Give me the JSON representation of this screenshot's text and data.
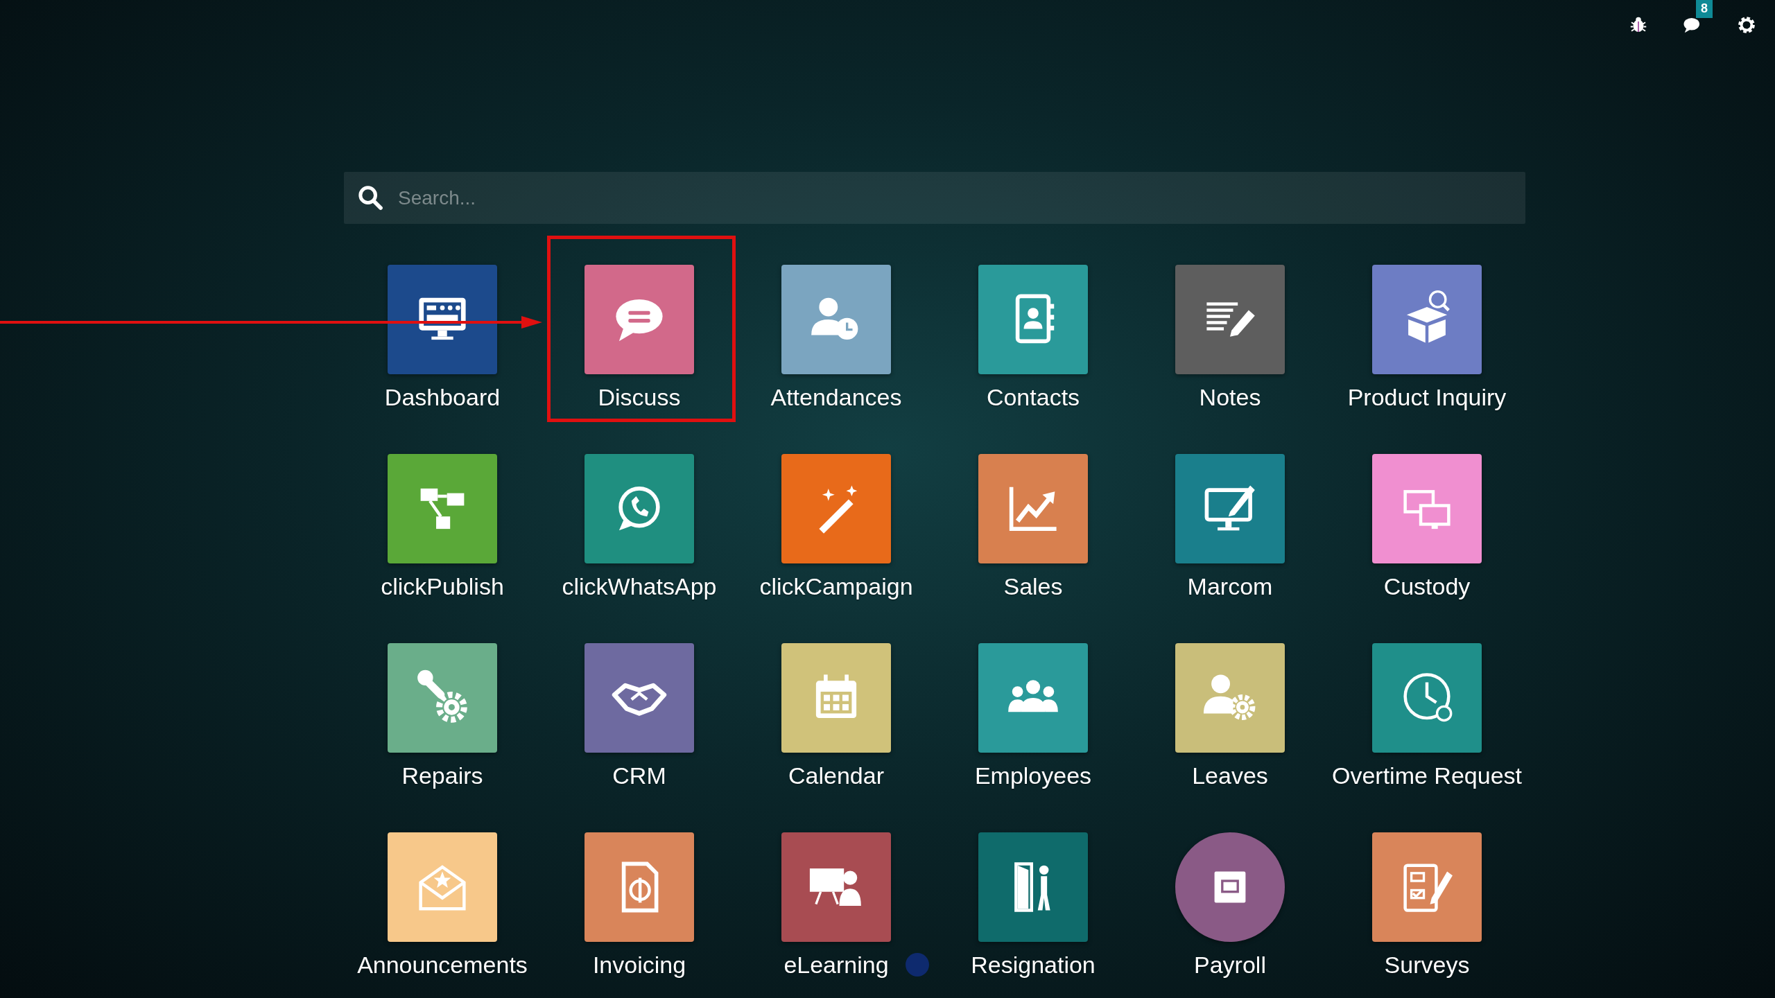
{
  "top_bar": {
    "messages_badge": "8"
  },
  "search": {
    "placeholder": "Search..."
  },
  "apps": [
    {
      "label": "Dashboard",
      "color": "#1c4a8c",
      "kind": "square",
      "dot": false
    },
    {
      "label": "Discuss",
      "color": "#d2698a",
      "kind": "square",
      "dot": false
    },
    {
      "label": "Attendances",
      "color": "#7ba5c0",
      "kind": "square",
      "dot": false
    },
    {
      "label": "Contacts",
      "color": "#2a9a9a",
      "kind": "square",
      "dot": false
    },
    {
      "label": "Notes",
      "color": "#5e5e5e",
      "kind": "square",
      "dot": false
    },
    {
      "label": "Product Inquiry",
      "color": "#6d7dc4",
      "kind": "square",
      "dot": false
    },
    {
      "label": "clickPublish",
      "color": "#5aa838",
      "kind": "square",
      "dot": false
    },
    {
      "label": "clickWhatsApp",
      "color": "#1f8f80",
      "kind": "square",
      "dot": false
    },
    {
      "label": "clickCampaign",
      "color": "#e86a1a",
      "kind": "square",
      "dot": false
    },
    {
      "label": "Sales",
      "color": "#d8804f",
      "kind": "square",
      "dot": false
    },
    {
      "label": "Marcom",
      "color": "#1a7f8c",
      "kind": "square",
      "dot": false
    },
    {
      "label": "Custody",
      "color": "#f08fd0",
      "kind": "square",
      "dot": false
    },
    {
      "label": "Repairs",
      "color": "#6aae8a",
      "kind": "square",
      "dot": false
    },
    {
      "label": "CRM",
      "color": "#6e6aa0",
      "kind": "square",
      "dot": false
    },
    {
      "label": "Calendar",
      "color": "#d0c27a",
      "kind": "square",
      "dot": false
    },
    {
      "label": "Employees",
      "color": "#2a9a9a",
      "kind": "square",
      "dot": false
    },
    {
      "label": "Leaves",
      "color": "#c9be7a",
      "kind": "square",
      "dot": false
    },
    {
      "label": "Overtime Request",
      "color": "#1f8f8a",
      "kind": "square",
      "dot": false
    },
    {
      "label": "Announcements",
      "color": "#f7c88a",
      "kind": "square",
      "dot": false
    },
    {
      "label": "Invoicing",
      "color": "#d9855a",
      "kind": "square",
      "dot": false
    },
    {
      "label": "eLearning",
      "color": "#a84c52",
      "kind": "square",
      "dot": true
    },
    {
      "label": "Resignation",
      "color": "#0f6b6b",
      "kind": "square",
      "dot": false
    },
    {
      "label": "Payroll",
      "color": "#8a5a86",
      "kind": "round",
      "dot": false
    },
    {
      "label": "Surveys",
      "color": "#d9855a",
      "kind": "square",
      "dot": false
    }
  ]
}
